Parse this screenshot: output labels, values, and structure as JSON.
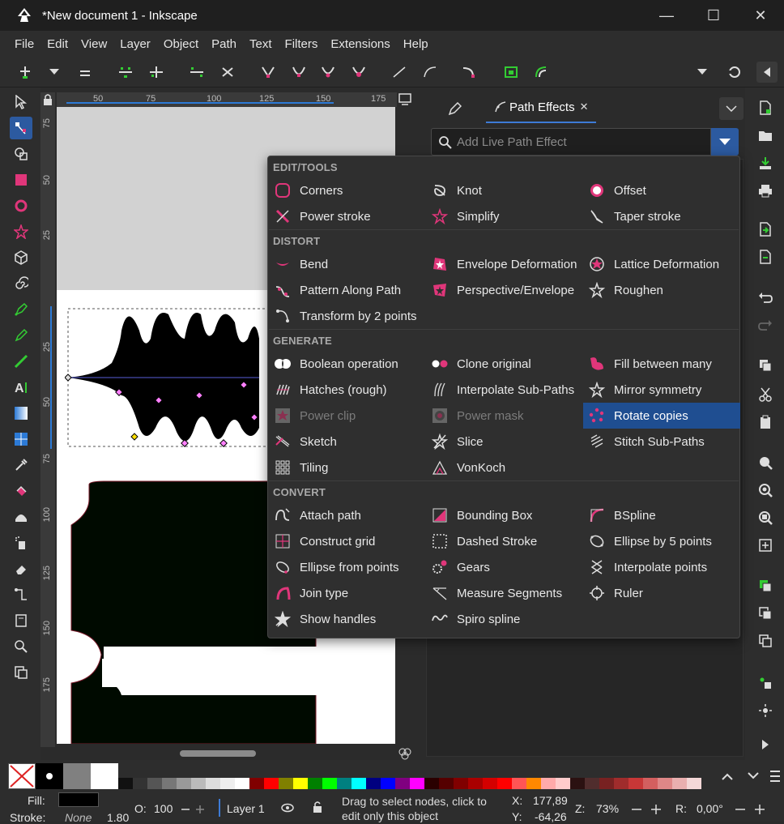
{
  "window": {
    "title": "*New document 1 - Inkscape",
    "minimize": "—",
    "maximize": "☐",
    "close": "✕"
  },
  "menu": [
    "File",
    "Edit",
    "View",
    "Layer",
    "Object",
    "Path",
    "Text",
    "Filters",
    "Extensions",
    "Help"
  ],
  "ruler": {
    "top": [
      "50",
      "75",
      "100",
      "125",
      "150",
      "175"
    ],
    "left": [
      "75",
      "50",
      "25",
      "25",
      "50",
      "75",
      "100",
      "125",
      "150",
      "175"
    ]
  },
  "panel": {
    "tab_path_effects": "Path Effects",
    "tab_close": "✕",
    "search_placeholder": "Add Live Path Effect"
  },
  "dropdown": {
    "sections": [
      {
        "title": "EDIT/TOOLS",
        "items": [
          {
            "label": "Corners",
            "icon": "corners-icon"
          },
          {
            "label": "Knot",
            "icon": "knot-icon"
          },
          {
            "label": "Offset",
            "icon": "offset-icon"
          },
          {
            "label": "Power stroke",
            "icon": "power-stroke-icon"
          },
          {
            "label": "Simplify",
            "icon": "simplify-icon"
          },
          {
            "label": "Taper stroke",
            "icon": "taper-stroke-icon"
          }
        ]
      },
      {
        "title": "DISTORT",
        "items": [
          {
            "label": "Bend",
            "icon": "bend-icon"
          },
          {
            "label": "Envelope Deformation",
            "icon": "envelope-icon"
          },
          {
            "label": "Lattice Deformation",
            "icon": "lattice-icon"
          },
          {
            "label": "Pattern Along Path",
            "icon": "pattern-along-path-icon"
          },
          {
            "label": "Perspective/Envelope",
            "icon": "perspective-icon"
          },
          {
            "label": "Roughen",
            "icon": "roughen-icon"
          },
          {
            "label": "Transform by 2 points",
            "icon": "transform-2pts-icon"
          }
        ]
      },
      {
        "title": "GENERATE",
        "items": [
          {
            "label": "Boolean operation",
            "icon": "boolean-icon"
          },
          {
            "label": "Clone original",
            "icon": "clone-original-icon"
          },
          {
            "label": "Fill between many",
            "icon": "fill-between-icon"
          },
          {
            "label": "Hatches (rough)",
            "icon": "hatches-icon"
          },
          {
            "label": "Interpolate Sub-Paths",
            "icon": "interpolate-subpaths-icon"
          },
          {
            "label": "Mirror symmetry",
            "icon": "mirror-icon"
          },
          {
            "label": "Power clip",
            "icon": "power-clip-icon",
            "disabled": true
          },
          {
            "label": "Power mask",
            "icon": "power-mask-icon",
            "disabled": true
          },
          {
            "label": "Rotate copies",
            "icon": "rotate-copies-icon",
            "selected": true
          },
          {
            "label": "Sketch",
            "icon": "sketch-icon"
          },
          {
            "label": "Slice",
            "icon": "slice-icon"
          },
          {
            "label": "Stitch Sub-Paths",
            "icon": "stitch-icon"
          },
          {
            "label": "Tiling",
            "icon": "tiling-icon"
          },
          {
            "label": "VonKoch",
            "icon": "vonkoch-icon"
          }
        ]
      },
      {
        "title": "CONVERT",
        "items": [
          {
            "label": "Attach path",
            "icon": "attach-path-icon"
          },
          {
            "label": "Bounding Box",
            "icon": "bounding-box-icon"
          },
          {
            "label": "BSpline",
            "icon": "bspline-icon"
          },
          {
            "label": "Construct grid",
            "icon": "construct-grid-icon"
          },
          {
            "label": "Dashed Stroke",
            "icon": "dashed-stroke-icon"
          },
          {
            "label": "Ellipse by 5 points",
            "icon": "ellipse-5pts-icon"
          },
          {
            "label": "Ellipse from points",
            "icon": "ellipse-points-icon"
          },
          {
            "label": "Gears",
            "icon": "gears-icon"
          },
          {
            "label": "Interpolate points",
            "icon": "interpolate-points-icon"
          },
          {
            "label": "Join type",
            "icon": "join-type-icon"
          },
          {
            "label": "Measure Segments",
            "icon": "measure-icon"
          },
          {
            "label": "Ruler",
            "icon": "ruler-icon"
          },
          {
            "label": "Show handles",
            "icon": "show-handles-icon"
          },
          {
            "label": "Spiro spline",
            "icon": "spiro-icon"
          }
        ]
      }
    ]
  },
  "status": {
    "fill_label": "Fill:",
    "stroke_label": "Stroke:",
    "stroke_value": "None",
    "stroke_width": "1.80",
    "opacity_label": "O:",
    "opacity_value": "100",
    "layer": "Layer 1",
    "message": "Drag to select nodes, click to edit only this object",
    "x_label": "X:",
    "x_value": "177,89",
    "y_label": "Y:",
    "y_value": "-64,26",
    "zoom_label": "Z:",
    "zoom_value": "73%",
    "rotate_label": "R:",
    "rotate_value": "0,00°"
  },
  "colors": {
    "accent": "#1f4e91",
    "pink": "#e0367a",
    "canvas_bg": "#d2d2d2"
  }
}
